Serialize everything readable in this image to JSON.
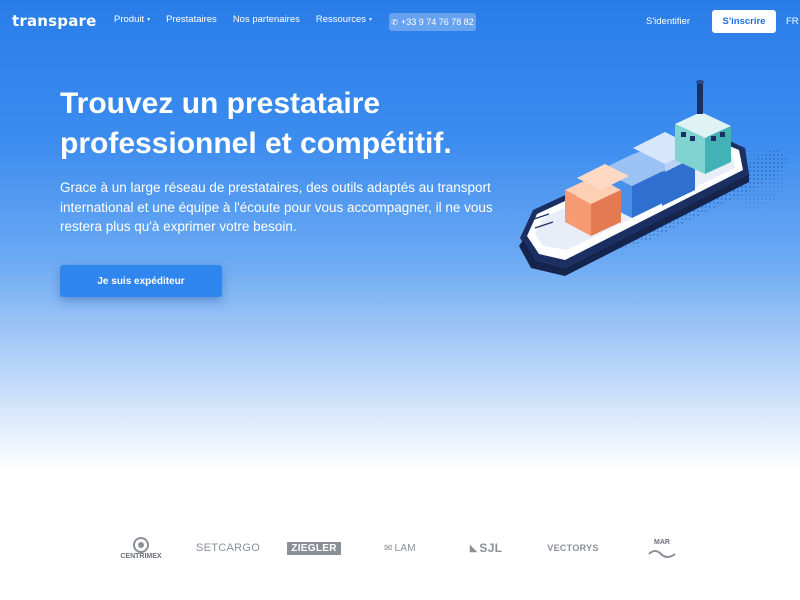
{
  "header": {
    "logo": "transpare",
    "nav": [
      {
        "label": "Produit",
        "has_caret": true
      },
      {
        "label": "Prestataires",
        "has_caret": false
      },
      {
        "label": "Nos partenaires",
        "has_caret": false
      },
      {
        "label": "Ressources",
        "has_caret": true
      }
    ],
    "phone": "+33 9 74 76 78 82",
    "signin_label": "S'identifier",
    "signup_label": "S'inscrire",
    "language": "FR"
  },
  "hero": {
    "title_line1": "Trouvez un prestataire",
    "title_line2": "professionnel et compétitif.",
    "subtitle": "Grace à un large réseau de prestataires, des outils adaptés au transport international et une équipe à l'écoute pour vous accompagner, il ne vous restera plus qu'à exprimer votre besoin.",
    "cta_label": "Je suis expéditeur"
  },
  "partners": [
    {
      "name": "centrimex",
      "label": "CENTRIMEX"
    },
    {
      "name": "setcargo",
      "label": "SETCARGO"
    },
    {
      "name": "ziegler",
      "label": "ZIEGLER"
    },
    {
      "name": "lam",
      "label": "LAM"
    },
    {
      "name": "sjl",
      "label": "SJL"
    },
    {
      "name": "vectorys",
      "label": "VECTORYS"
    },
    {
      "name": "marsol",
      "label": "MAR"
    }
  ],
  "colors": {
    "brand_blue": "#2a7de8",
    "cta_blue": "#2f86ee",
    "white": "#ffffff"
  }
}
